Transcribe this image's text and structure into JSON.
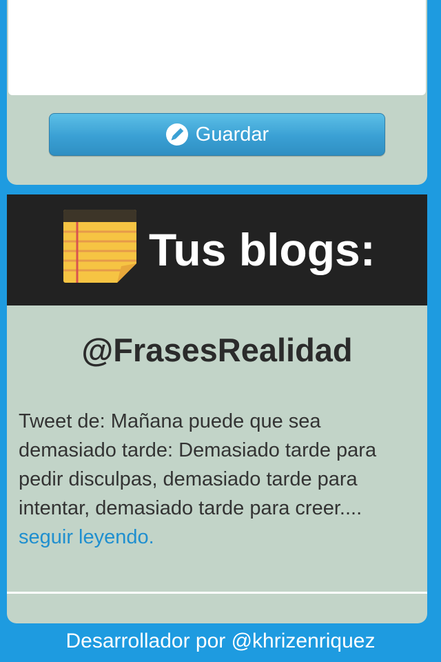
{
  "compose": {
    "text_value": "",
    "save_label": "Guardar",
    "save_icon": "pencil-icon"
  },
  "blogs": {
    "title": "Tus blogs:",
    "title_icon": "notepad-icon",
    "handle": "@FrasesRealidad",
    "tweet_text": "Tweet de: Mañana puede que sea demasiado tarde: Demasiado tarde para pedir disculpas, demasiado tarde para intentar, demasiado tarde para creer.... ",
    "read_more_label": "seguir leyendo."
  },
  "footer": {
    "credit": "Desarrollador por @khrizenriquez"
  },
  "colors": {
    "background": "#1e9be0",
    "card": "#c2d4c8",
    "header": "#222222",
    "link": "#1f8fcf",
    "button": "#3aa0d4"
  }
}
